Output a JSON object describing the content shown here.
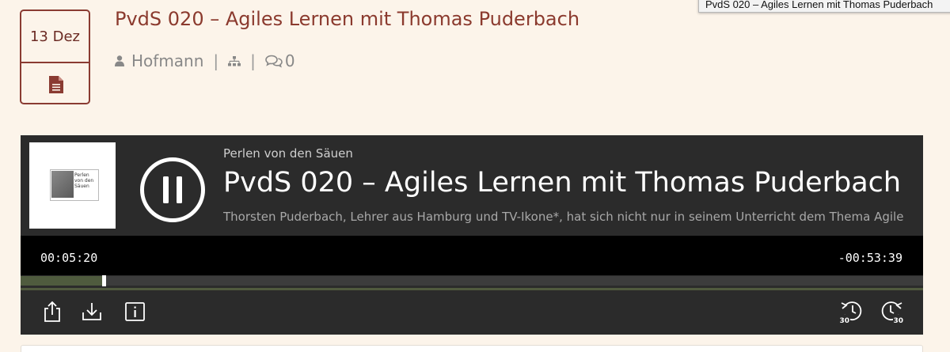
{
  "tooltip": {
    "text": "PvdS 020 – Agiles Lernen mit Thomas Puderbach"
  },
  "post": {
    "date": "13 Dez",
    "title": "PvdS 020 – Agiles Lernen mit Thomas Puderbach",
    "author": "Hofmann",
    "separator": "|",
    "comments": "0"
  },
  "player": {
    "show_name": "Perlen von den Säuen",
    "episode_title": "PvdS 020 – Agiles Lernen mit Thomas Puderbach",
    "description": "Thorsten Puderbach, Lehrer aus Hamburg und TV-Ikone*, hat sich nicht nur in seinem Unterricht dem Thema Agile...",
    "cover_text": "Perlen von den Säuen",
    "time_current": "00:05:20",
    "time_remaining": "-00:53:39",
    "progress_fraction": 0.092,
    "state": "playing",
    "accent_color": "#4f5b3e",
    "controls": [
      "share-icon",
      "download-icon",
      "info-icon",
      "rewind-30-icon",
      "forward-30-icon"
    ],
    "skip_seconds": "30"
  }
}
